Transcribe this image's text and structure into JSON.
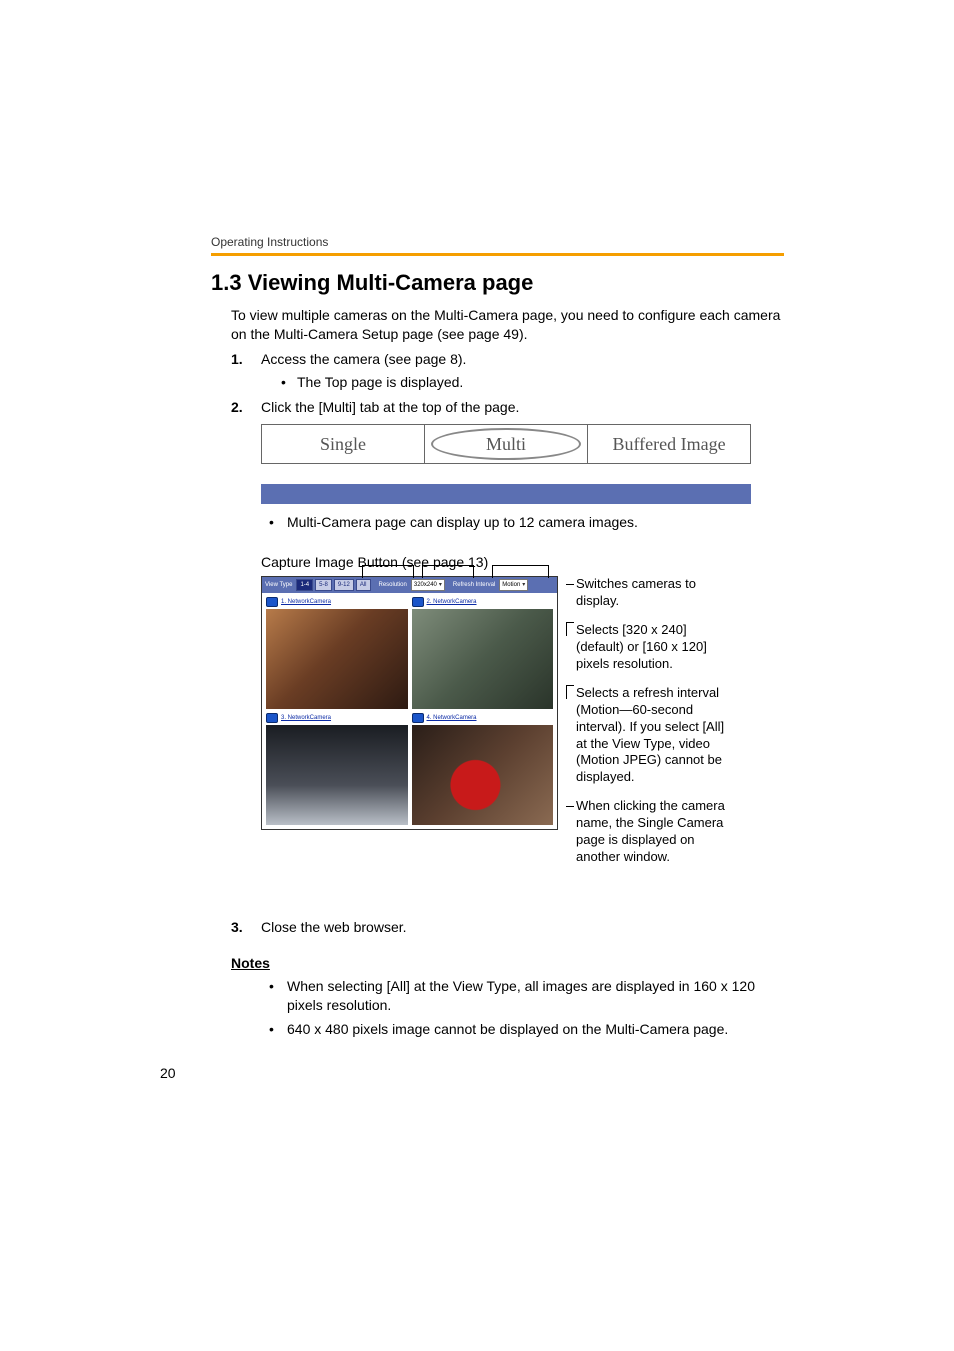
{
  "header": {
    "running_head": "Operating Instructions"
  },
  "section": {
    "title": "1.3   Viewing Multi-Camera page",
    "intro": "To view multiple cameras on the Multi-Camera page, you need to configure each camera on the Multi-Camera Setup page (see page 49)."
  },
  "steps": {
    "s1_num": "1.",
    "s1_text": "Access the camera (see page 8).",
    "s1_sub1": "The Top page is displayed.",
    "s2_num": "2.",
    "s2_text": "Click the [Multi] tab at the top of the page.",
    "s3_num": "3.",
    "s3_text": "Close the web browser."
  },
  "tabs": {
    "single": "Single",
    "multi": "Multi",
    "buffered": "Buffered Image"
  },
  "figure_note": "Multi-Camera page can display up to 12 camera images.",
  "capture_caption": "Capture Image Button (see page 13)",
  "multicam": {
    "toolbar": {
      "view_type_label": "View Type",
      "btn_1_4": "1-4",
      "btn_5_8": "5-8",
      "btn_9_12": "9-12",
      "btn_all": "All",
      "resolution_label": "Resolution",
      "resolution_value": "320x240",
      "refresh_label": "Refresh Interval",
      "refresh_value": "Motion"
    },
    "cameras": {
      "c1": "1. NetworkCamera",
      "c2": "2. NetworkCamera",
      "c3": "3. NetworkCamera",
      "c4": "4. NetworkCamera"
    }
  },
  "annotations": {
    "a1": "Switches cameras to display.",
    "a2": "Selects [320 x 240] (default) or [160 x 120] pixels resolution.",
    "a3": "Selects a refresh interval (Motion—60-second interval). If you select [All] at the View Type, video (Motion JPEG) cannot be displayed.",
    "a4": "When clicking the camera name, the Single Camera page is displayed on another window."
  },
  "notes": {
    "heading": "Notes",
    "n1": "When selecting [All] at the View Type, all images are displayed in 160 x 120 pixels resolution.",
    "n2": "640 x 480 pixels image cannot be displayed on the Multi-Camera page."
  },
  "page_number": "20"
}
